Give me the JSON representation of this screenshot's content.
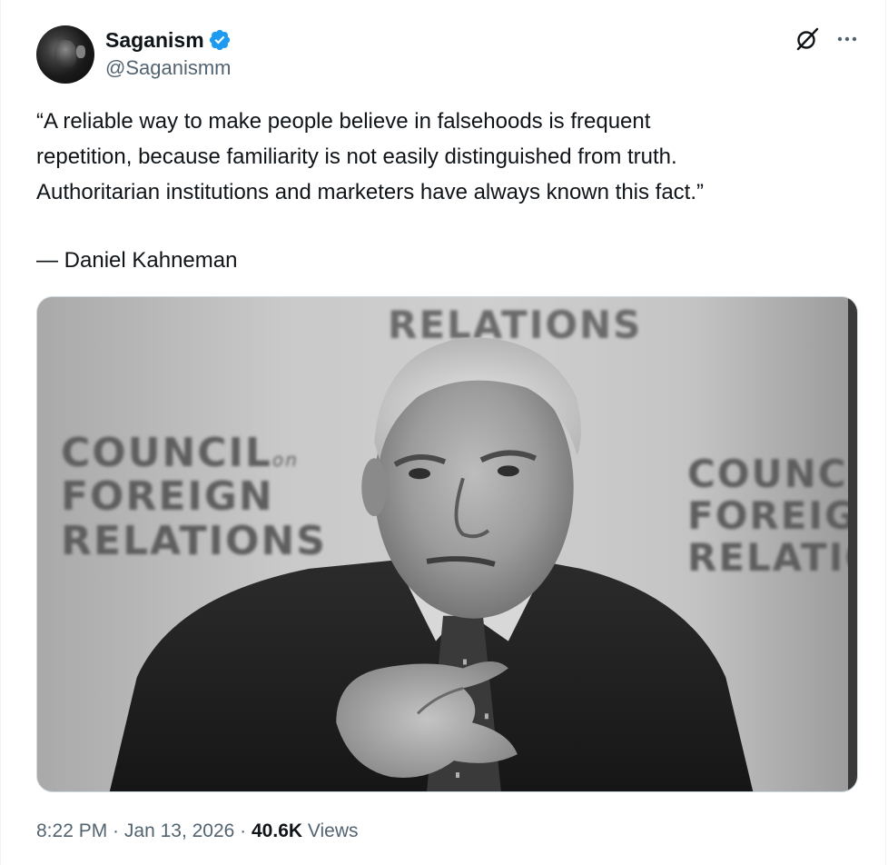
{
  "author": {
    "display_name": "Saganism",
    "handle": "@Saganismm",
    "verified_color": "#1d9bf0"
  },
  "icons": {
    "grok": "grok-icon",
    "more": "more-icon",
    "verified": "verified-badge-icon"
  },
  "tweet": {
    "text": "“A reliable way to make people believe in falsehoods is frequent\nrepetition, because familiarity is not easily distinguished from truth.\nAuthoritarian institutions and marketers have always known this fact.”",
    "attribution": "— Daniel Kahneman"
  },
  "media": {
    "backdrop_top": "RELATIONS",
    "backdrop_left_line1": "COUNCIL",
    "backdrop_left_on": "on",
    "backdrop_left_line2": "FOREIGN",
    "backdrop_left_line3": "RELATIONS",
    "backdrop_right_line1": "COUNCIL",
    "backdrop_right_line2": "FOREIGN",
    "backdrop_right_line3": "RELATION"
  },
  "meta": {
    "time": "8:22 PM",
    "separator": " · ",
    "date": "Jan 13, 2026",
    "views_count": "40.6K",
    "views_label": " Views"
  }
}
